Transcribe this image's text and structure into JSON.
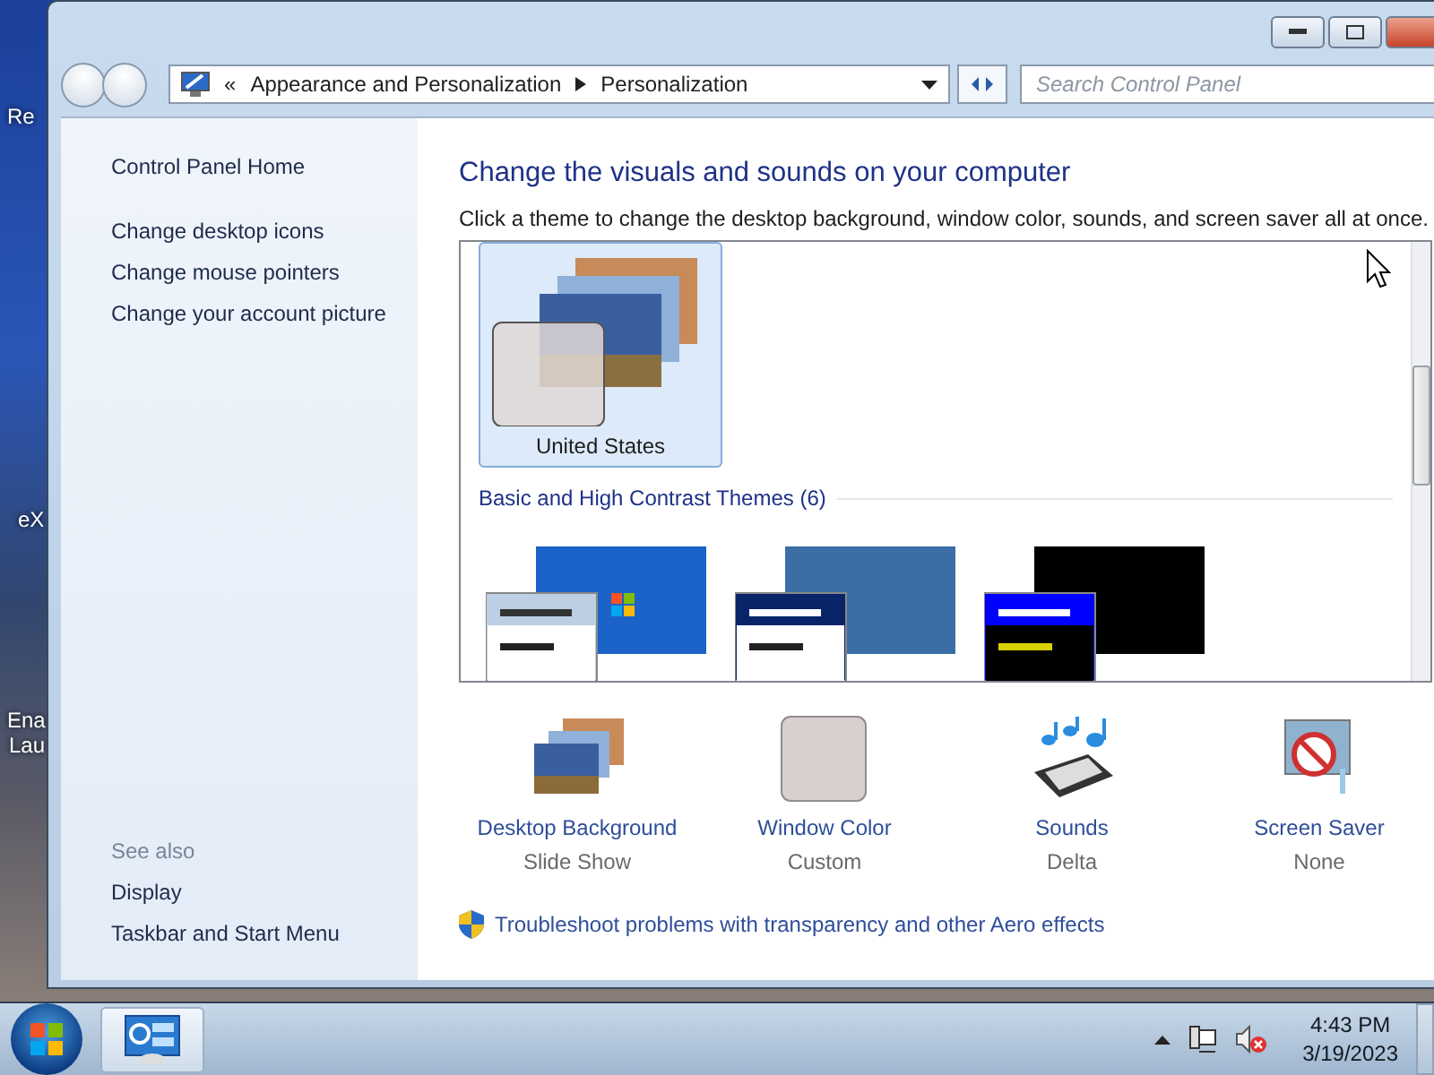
{
  "desktop_icons": [
    {
      "lines": [
        "Re"
      ]
    },
    {
      "lines": [
        "eX"
      ]
    },
    {
      "lines": [
        "Ena",
        "Lau"
      ]
    }
  ],
  "window": {
    "address": {
      "overflow": "«",
      "breadcrumbs": [
        "Appearance and Personalization",
        "Personalization"
      ]
    },
    "search": {
      "placeholder": "Search Control Panel"
    }
  },
  "sidebar": {
    "links": [
      "Control Panel Home",
      "Change desktop icons",
      "Change mouse pointers",
      "Change your account picture"
    ],
    "see_also_title": "See also",
    "see_also": [
      "Display",
      "Taskbar and Start Menu"
    ]
  },
  "content": {
    "heading": "Change the visuals and sounds on your computer",
    "instruction": "Click a theme to change the desktop background, window color, sounds, and screen saver all at once.",
    "themes": [
      {
        "name": "United States",
        "selected": true
      }
    ],
    "group": {
      "title": "Basic and High Contrast Themes (6)",
      "thumbnails": [
        {
          "kind": "aero-basic"
        },
        {
          "kind": "classic"
        },
        {
          "kind": "high-contrast"
        }
      ]
    },
    "settings": [
      {
        "kind": "background",
        "label": "Desktop Background",
        "value": "Slide Show"
      },
      {
        "kind": "color",
        "label": "Window Color",
        "value": "Custom"
      },
      {
        "kind": "sounds",
        "label": "Sounds",
        "value": "Delta"
      },
      {
        "kind": "screensaver",
        "label": "Screen Saver",
        "value": "None"
      }
    ],
    "troubleshoot_link": "Troubleshoot problems with transparency and other Aero effects"
  },
  "taskbar": {
    "time": "4:43 PM",
    "date": "3/19/2023"
  }
}
